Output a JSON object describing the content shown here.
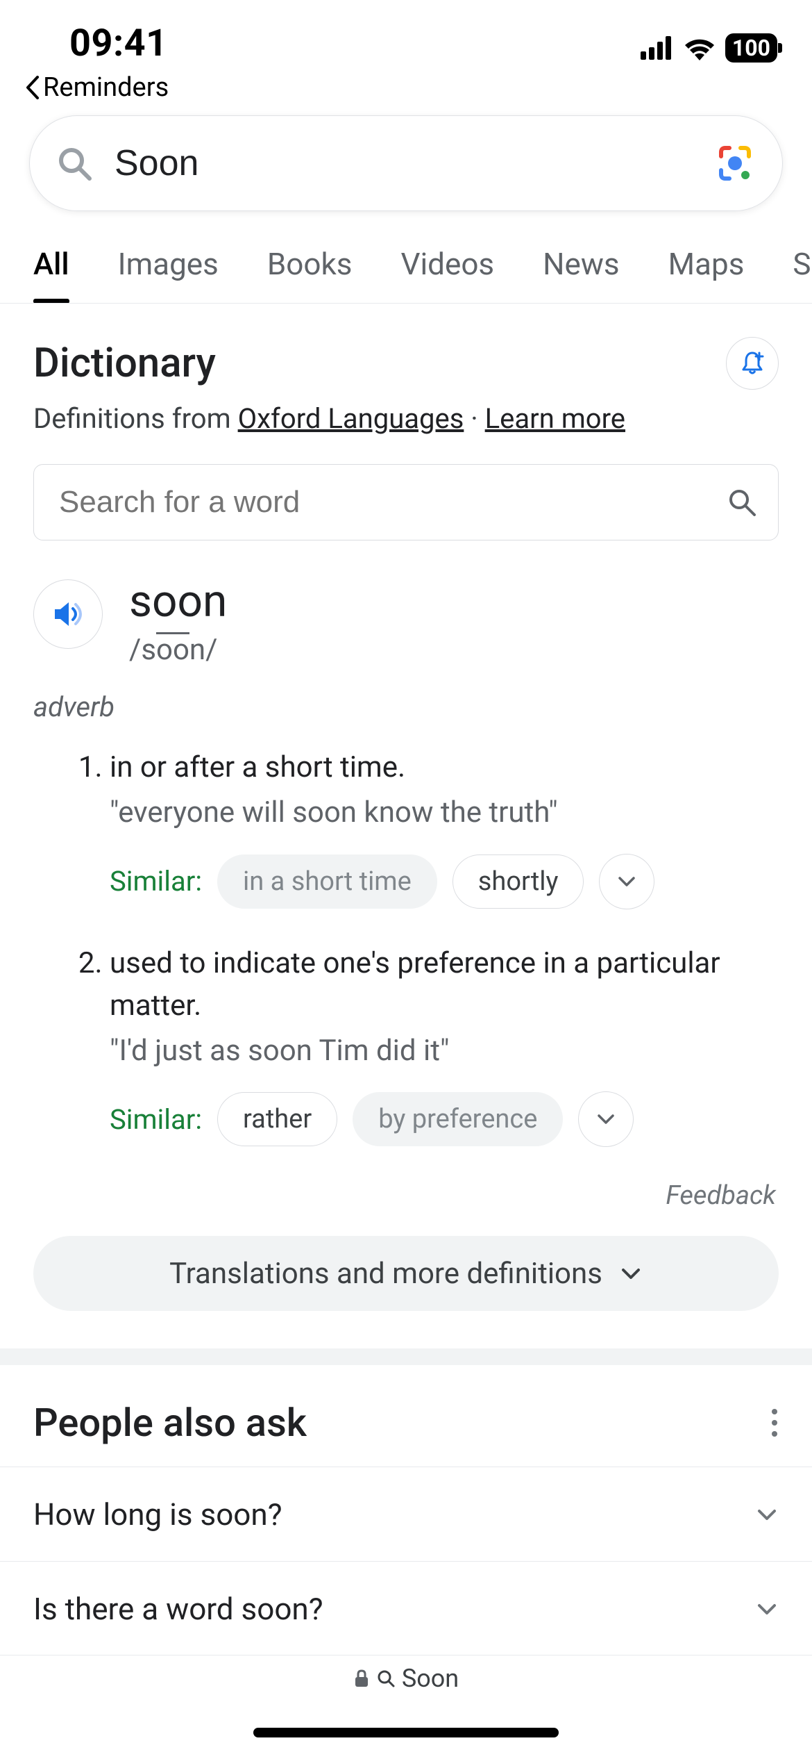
{
  "status": {
    "time": "09:41",
    "battery": "100",
    "back_app": "Reminders"
  },
  "search": {
    "query": "Soon"
  },
  "tabs": [
    "All",
    "Images",
    "Books",
    "Videos",
    "News",
    "Maps",
    "S"
  ],
  "dictionary": {
    "title": "Dictionary",
    "source_prefix": "Definitions from ",
    "source_link": "Oxford Languages",
    "sep": " · ",
    "learn_more": "Learn more",
    "search_placeholder": "Search for a word",
    "word": "soon",
    "pos": "adverb",
    "defs": [
      {
        "text": "in or after a short time.",
        "example": "\"everyone will soon know the truth\"",
        "similar_label": "Similar:",
        "similar": [
          {
            "label": "in a short time",
            "muted": true
          },
          {
            "label": "shortly",
            "muted": false
          }
        ]
      },
      {
        "text": "used to indicate one's preference in a particular matter.",
        "example": "\"I'd just as soon Tim did it\"",
        "similar_label": "Similar:",
        "similar": [
          {
            "label": "rather",
            "muted": false
          },
          {
            "label": "by preference",
            "muted": true
          }
        ]
      }
    ],
    "feedback": "Feedback",
    "translations_button": "Translations and more definitions"
  },
  "paa": {
    "title": "People also ask",
    "items": [
      "How long is soon?",
      "Is there a word soon?"
    ]
  },
  "bottom": {
    "label": "Soon"
  }
}
